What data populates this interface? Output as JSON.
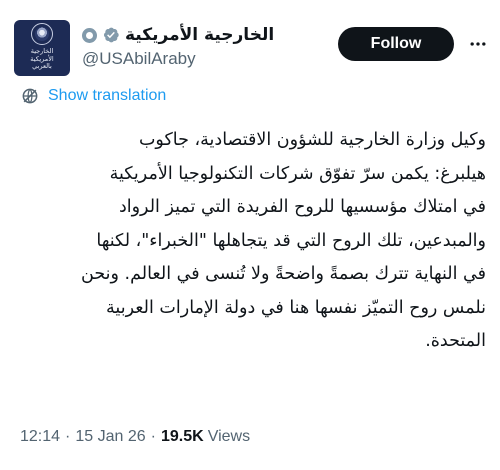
{
  "author": {
    "display_name": "الخارجية الأمريكية",
    "handle": "@USAbilAraby",
    "avatar_text": "الخارجية الأمريكية\nبالعربي"
  },
  "follow_label": "Follow",
  "translation_label": "Show translation",
  "tweet_lines": [
    "وكيل وزارة الخارجية للشؤون الاقتصادية، جاكوب",
    "هيلبرغ: يكمن سرّ تفوّق شركات التكنولوجيا الأمريكية",
    "في امتلاك مؤسسيها للروح الفريدة التي تميز الرواد",
    "والمبدعين، تلك الروح التي قد يتجاهلها \"الخبراء\"، لكنها",
    "في النهاية تترك بصمةً واضحةً ولا تُنسى في العالم. ونحن",
    "نلمس روح التميّز نفسها هنا في دولة الإمارات العربية",
    "المتحدة."
  ],
  "meta": {
    "time": "12:14",
    "date": "15 Jan 26",
    "views_count": "19.5K",
    "views_label": "Views",
    "separator": "·"
  },
  "colors": {
    "link": "#1d9bf0",
    "verified_badge": "#829aab",
    "follow_button_bg": "#0f1419",
    "secondary_text": "#536471",
    "avatar_bg": "#1d2b55"
  },
  "icons": {
    "verified": "verified-badge-icon",
    "government": "government-badge-icon",
    "more": "more-options-icon",
    "translate": "globe-icon"
  }
}
